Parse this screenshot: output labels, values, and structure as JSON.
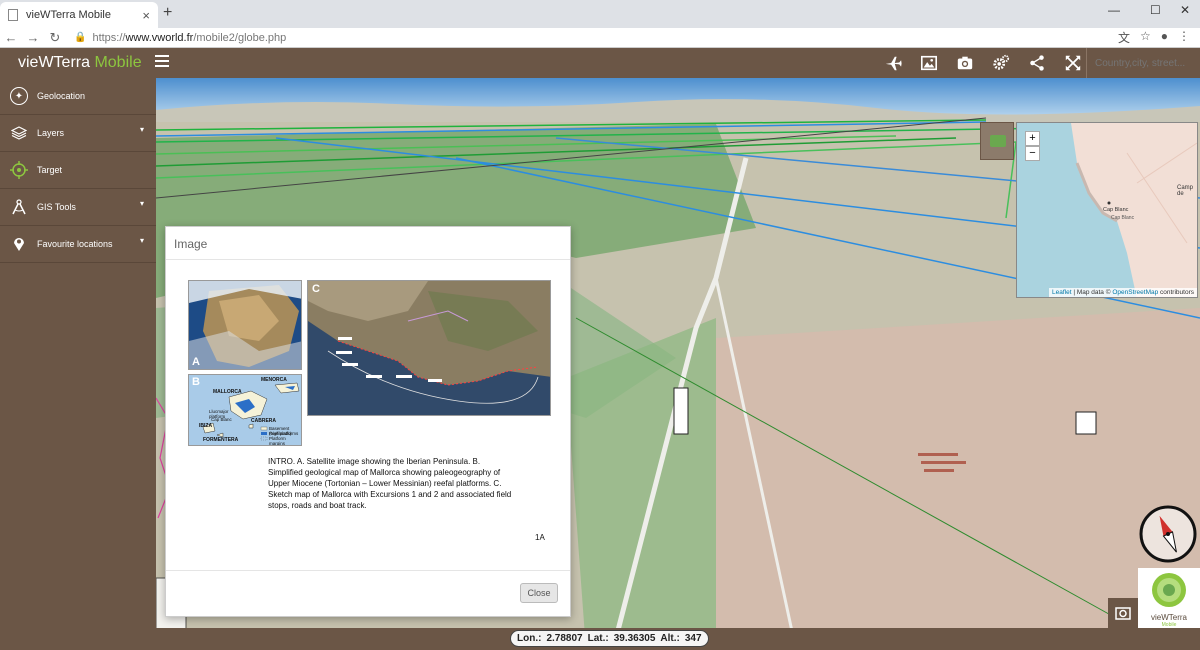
{
  "browser": {
    "tab_title": "vieWTerra Mobile",
    "url_scheme": "https://",
    "url_host": "www.vworld.fr",
    "url_path": "/mobile2/globe.php"
  },
  "app": {
    "brand_main": "vieWTerra ",
    "brand_accent": "Mobile",
    "search_placeholder": "Country,city, street..."
  },
  "sidebar": {
    "items": [
      {
        "label": "Geolocation",
        "icon": "compass-icon",
        "chevron": false
      },
      {
        "label": "Layers",
        "icon": "layers-icon",
        "chevron": true
      },
      {
        "label": "Target",
        "icon": "target-icon",
        "chevron": false
      },
      {
        "label": "GIS Tools",
        "icon": "gis-tools-icon",
        "chevron": true
      },
      {
        "label": "Favourite locations",
        "icon": "map-pin-icon",
        "chevron": true
      }
    ]
  },
  "minimap": {
    "zoom_in": "+",
    "zoom_out": "−",
    "place_labels": [
      "Cap Blanc",
      "Cap Blanc",
      "Camp de"
    ],
    "attribution_leaflet": "Leaflet",
    "attribution_sep": " | Map data © ",
    "attribution_osm": "OpenStreetMap",
    "attribution_end": " contributors"
  },
  "modal": {
    "title": "Image",
    "fig_labels": [
      "A",
      "B",
      "C"
    ],
    "map_b_labels": {
      "mallorca": "MALLORCA",
      "menorca": "MENORCA",
      "ibiza": "IBIZA",
      "cabrera": "CABRERA",
      "formentera": "FORMENTERA",
      "cap_blanc": "Cap Blanc",
      "llucmajor": "Llucmajor platform",
      "legend_1": "Basement (highlands)",
      "legend_2": "Reef platforms",
      "legend_3": "Platform margins"
    },
    "caption": "INTRO. A. Satellite image showing the Iberian Peninsula. B. Simplified geological map of Mallorca showing paleogeography of Upper Miocene (Tortonian – Lower Messinian) reefal platforms. C. Sketch map of Mallorca with Excursions 1 and 2 and associated field stops, roads and boat track.",
    "caption_id": "1A",
    "close_label": "Close"
  },
  "status": {
    "lon_label": "Lon.:",
    "lon": "2.78807",
    "lat_label": "Lat.:",
    "lat": "39.36305",
    "alt_label": "Alt.:",
    "alt": "347"
  },
  "logo": {
    "name": "vieWTerra",
    "sub": "Mobile"
  },
  "colors": {
    "header_bg": "#6b5646",
    "brand_accent": "#8dc63f"
  }
}
